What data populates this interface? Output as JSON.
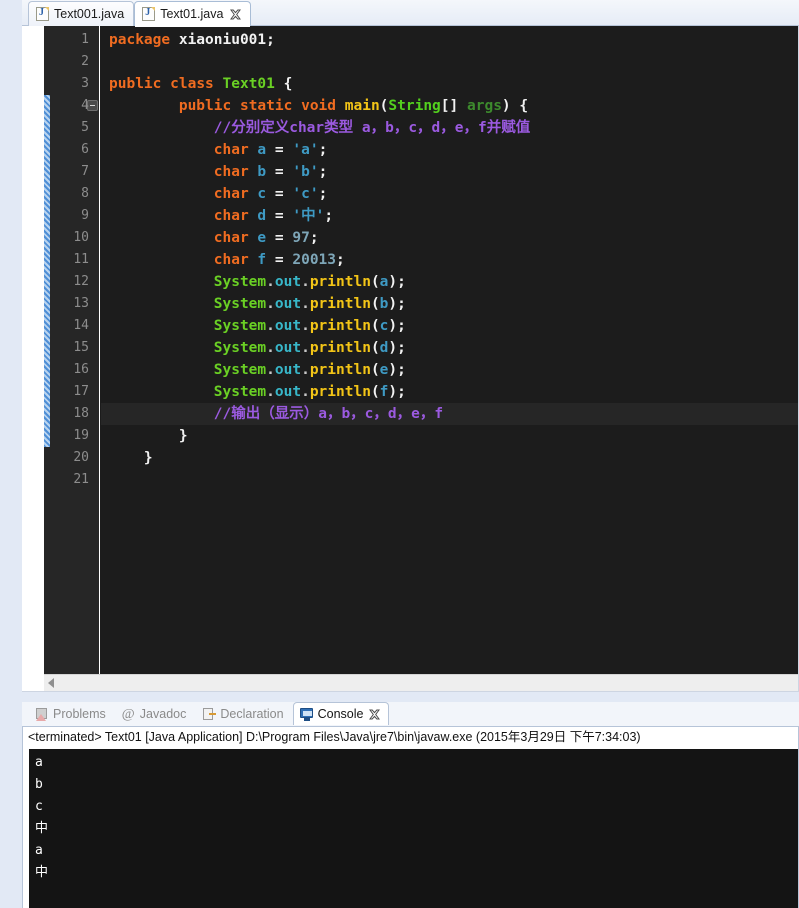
{
  "editor": {
    "tabs": [
      {
        "label": "Text001.java",
        "icon": "java-file-icon",
        "active": false,
        "closable": false
      },
      {
        "label": "Text01.java",
        "icon": "java-file-icon",
        "active": true,
        "closable": true
      }
    ],
    "gutter": {
      "first_line": 1,
      "last_line": 21,
      "range_bar_from_line": 4,
      "range_bar_to_line": 19,
      "fold_marker_line": 4
    },
    "current_line": 18,
    "lines": [
      {
        "n": 1,
        "tokens": [
          {
            "t": "kw",
            "s": "package"
          },
          {
            "t": "plain",
            "s": " "
          },
          {
            "t": "plain",
            "s": "xiaoniu001;"
          }
        ]
      },
      {
        "n": 2,
        "tokens": []
      },
      {
        "n": 3,
        "tokens": [
          {
            "t": "kw",
            "s": "public"
          },
          {
            "t": "plain",
            "s": " "
          },
          {
            "t": "kw",
            "s": "class"
          },
          {
            "t": "plain",
            "s": " "
          },
          {
            "t": "cls",
            "s": "Text01"
          },
          {
            "t": "plain",
            "s": " {"
          }
        ]
      },
      {
        "n": 4,
        "tokens": [
          {
            "t": "plain",
            "s": "        "
          },
          {
            "t": "kw",
            "s": "public"
          },
          {
            "t": "plain",
            "s": " "
          },
          {
            "t": "kw",
            "s": "static"
          },
          {
            "t": "plain",
            "s": " "
          },
          {
            "t": "kw",
            "s": "void"
          },
          {
            "t": "plain",
            "s": " "
          },
          {
            "t": "mth",
            "s": "main"
          },
          {
            "t": "plain",
            "s": "("
          },
          {
            "t": "type",
            "s": "String"
          },
          {
            "t": "plain",
            "s": "[] "
          },
          {
            "t": "arg",
            "s": "args"
          },
          {
            "t": "plain",
            "s": ") {"
          }
        ]
      },
      {
        "n": 5,
        "tokens": [
          {
            "t": "plain",
            "s": "            "
          },
          {
            "t": "cmt",
            "s": "//分别定义char类型 a，b，c，d，e，f并赋值"
          }
        ]
      },
      {
        "n": 6,
        "tokens": [
          {
            "t": "plain",
            "s": "            "
          },
          {
            "t": "kw",
            "s": "char"
          },
          {
            "t": "plain",
            "s": " "
          },
          {
            "t": "var",
            "s": "a"
          },
          {
            "t": "plain",
            "s": " = "
          },
          {
            "t": "str",
            "s": "'a'"
          },
          {
            "t": "plain",
            "s": ";"
          }
        ]
      },
      {
        "n": 7,
        "tokens": [
          {
            "t": "plain",
            "s": "            "
          },
          {
            "t": "kw",
            "s": "char"
          },
          {
            "t": "plain",
            "s": " "
          },
          {
            "t": "var",
            "s": "b"
          },
          {
            "t": "plain",
            "s": " = "
          },
          {
            "t": "str",
            "s": "'b'"
          },
          {
            "t": "plain",
            "s": ";"
          }
        ]
      },
      {
        "n": 8,
        "tokens": [
          {
            "t": "plain",
            "s": "            "
          },
          {
            "t": "kw",
            "s": "char"
          },
          {
            "t": "plain",
            "s": " "
          },
          {
            "t": "var",
            "s": "c"
          },
          {
            "t": "plain",
            "s": " = "
          },
          {
            "t": "str",
            "s": "'c'"
          },
          {
            "t": "plain",
            "s": ";"
          }
        ]
      },
      {
        "n": 9,
        "tokens": [
          {
            "t": "plain",
            "s": "            "
          },
          {
            "t": "kw",
            "s": "char"
          },
          {
            "t": "plain",
            "s": " "
          },
          {
            "t": "var",
            "s": "d"
          },
          {
            "t": "plain",
            "s": " = "
          },
          {
            "t": "str",
            "s": "'中'"
          },
          {
            "t": "plain",
            "s": ";"
          }
        ]
      },
      {
        "n": 10,
        "tokens": [
          {
            "t": "plain",
            "s": "            "
          },
          {
            "t": "kw",
            "s": "char"
          },
          {
            "t": "plain",
            "s": " "
          },
          {
            "t": "var",
            "s": "e"
          },
          {
            "t": "plain",
            "s": " = "
          },
          {
            "t": "num",
            "s": "97"
          },
          {
            "t": "plain",
            "s": ";"
          }
        ]
      },
      {
        "n": 11,
        "tokens": [
          {
            "t": "plain",
            "s": "            "
          },
          {
            "t": "kw",
            "s": "char"
          },
          {
            "t": "plain",
            "s": " "
          },
          {
            "t": "var",
            "s": "f"
          },
          {
            "t": "plain",
            "s": " = "
          },
          {
            "t": "num",
            "s": "20013"
          },
          {
            "t": "plain",
            "s": ";"
          }
        ]
      },
      {
        "n": 12,
        "tokens": [
          {
            "t": "plain",
            "s": "            "
          },
          {
            "t": "cls",
            "s": "System"
          },
          {
            "t": "dot",
            "s": "."
          },
          {
            "t": "fld",
            "s": "out"
          },
          {
            "t": "dot",
            "s": "."
          },
          {
            "t": "mth",
            "s": "println"
          },
          {
            "t": "plain",
            "s": "("
          },
          {
            "t": "var",
            "s": "a"
          },
          {
            "t": "plain",
            "s": ");"
          }
        ]
      },
      {
        "n": 13,
        "tokens": [
          {
            "t": "plain",
            "s": "            "
          },
          {
            "t": "cls",
            "s": "System"
          },
          {
            "t": "dot",
            "s": "."
          },
          {
            "t": "fld",
            "s": "out"
          },
          {
            "t": "dot",
            "s": "."
          },
          {
            "t": "mth",
            "s": "println"
          },
          {
            "t": "plain",
            "s": "("
          },
          {
            "t": "var",
            "s": "b"
          },
          {
            "t": "plain",
            "s": ");"
          }
        ]
      },
      {
        "n": 14,
        "tokens": [
          {
            "t": "plain",
            "s": "            "
          },
          {
            "t": "cls",
            "s": "System"
          },
          {
            "t": "dot",
            "s": "."
          },
          {
            "t": "fld",
            "s": "out"
          },
          {
            "t": "dot",
            "s": "."
          },
          {
            "t": "mth",
            "s": "println"
          },
          {
            "t": "plain",
            "s": "("
          },
          {
            "t": "var",
            "s": "c"
          },
          {
            "t": "plain",
            "s": ");"
          }
        ]
      },
      {
        "n": 15,
        "tokens": [
          {
            "t": "plain",
            "s": "            "
          },
          {
            "t": "cls",
            "s": "System"
          },
          {
            "t": "dot",
            "s": "."
          },
          {
            "t": "fld",
            "s": "out"
          },
          {
            "t": "dot",
            "s": "."
          },
          {
            "t": "mth",
            "s": "println"
          },
          {
            "t": "plain",
            "s": "("
          },
          {
            "t": "var",
            "s": "d"
          },
          {
            "t": "plain",
            "s": ");"
          }
        ]
      },
      {
        "n": 16,
        "tokens": [
          {
            "t": "plain",
            "s": "            "
          },
          {
            "t": "cls",
            "s": "System"
          },
          {
            "t": "dot",
            "s": "."
          },
          {
            "t": "fld",
            "s": "out"
          },
          {
            "t": "dot",
            "s": "."
          },
          {
            "t": "mth",
            "s": "println"
          },
          {
            "t": "plain",
            "s": "("
          },
          {
            "t": "var",
            "s": "e"
          },
          {
            "t": "plain",
            "s": ");"
          }
        ]
      },
      {
        "n": 17,
        "tokens": [
          {
            "t": "plain",
            "s": "            "
          },
          {
            "t": "cls",
            "s": "System"
          },
          {
            "t": "dot",
            "s": "."
          },
          {
            "t": "fld",
            "s": "out"
          },
          {
            "t": "dot",
            "s": "."
          },
          {
            "t": "mth",
            "s": "println"
          },
          {
            "t": "plain",
            "s": "("
          },
          {
            "t": "var",
            "s": "f"
          },
          {
            "t": "plain",
            "s": ");"
          }
        ]
      },
      {
        "n": 18,
        "tokens": [
          {
            "t": "plain",
            "s": "            "
          },
          {
            "t": "cmt",
            "s": "//输出（显示）a，b，c，d，e，f"
          }
        ]
      },
      {
        "n": 19,
        "tokens": [
          {
            "t": "plain",
            "s": "        }"
          }
        ]
      },
      {
        "n": 20,
        "tokens": [
          {
            "t": "plain",
            "s": "    }"
          }
        ]
      },
      {
        "n": 21,
        "tokens": []
      }
    ],
    "hscrollbar": {
      "left_arrow_icon": "triangle-left-icon"
    }
  },
  "console_panel": {
    "tabs": [
      {
        "label": "Problems",
        "icon": "problems-icon",
        "active": false,
        "closable": false
      },
      {
        "label": "Javadoc",
        "icon": "javadoc-icon",
        "active": false,
        "closable": false
      },
      {
        "label": "Declaration",
        "icon": "declaration-icon",
        "active": false,
        "closable": false
      },
      {
        "label": "Console",
        "icon": "console-icon",
        "active": true,
        "closable": true
      }
    ],
    "header": "<terminated> Text01 [Java Application] D:\\Program Files\\Java\\jre7\\bin\\javaw.exe (2015年3月29日 下午7:34:03)",
    "output": [
      "a",
      "b",
      "c",
      "中",
      "a",
      "中"
    ]
  },
  "colors": {
    "editor_background": "#1c1c1c",
    "gutter_background": "#262626",
    "current_line_background": "#262626",
    "keyword": "#f06c21",
    "type": "#53d01e",
    "class": "#6ad024",
    "field": "#38b7c9",
    "method": "#f3c517",
    "variable": "#3e9ac4",
    "string": "#3e9ac4",
    "number": "#7ea6b8",
    "comment": "#9b5ae0",
    "argument": "#3d8b2d",
    "console_background": "#141414",
    "console_text": "#ffffff",
    "chrome_background": "#e2e9f5"
  }
}
